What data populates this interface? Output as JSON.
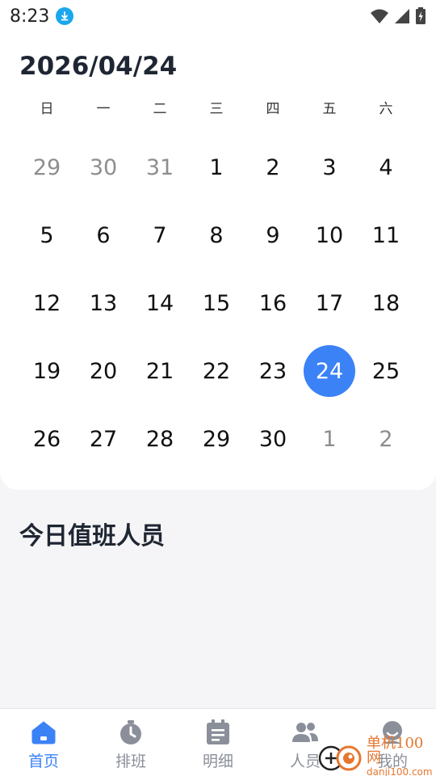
{
  "status_bar": {
    "time": "8:23"
  },
  "calendar": {
    "date_title": "2026/04/24",
    "weekdays": [
      "日",
      "一",
      "二",
      "三",
      "四",
      "五",
      "六"
    ],
    "days": [
      {
        "label": "29",
        "muted": true
      },
      {
        "label": "30",
        "muted": true
      },
      {
        "label": "31",
        "muted": true
      },
      {
        "label": "1"
      },
      {
        "label": "2"
      },
      {
        "label": "3"
      },
      {
        "label": "4"
      },
      {
        "label": "5"
      },
      {
        "label": "6"
      },
      {
        "label": "7"
      },
      {
        "label": "8"
      },
      {
        "label": "9"
      },
      {
        "label": "10"
      },
      {
        "label": "11"
      },
      {
        "label": "12"
      },
      {
        "label": "13"
      },
      {
        "label": "14"
      },
      {
        "label": "15"
      },
      {
        "label": "16"
      },
      {
        "label": "17"
      },
      {
        "label": "18"
      },
      {
        "label": "19"
      },
      {
        "label": "20"
      },
      {
        "label": "21"
      },
      {
        "label": "22"
      },
      {
        "label": "23"
      },
      {
        "label": "24",
        "selected": true
      },
      {
        "label": "25"
      },
      {
        "label": "26"
      },
      {
        "label": "27"
      },
      {
        "label": "28"
      },
      {
        "label": "29"
      },
      {
        "label": "30"
      },
      {
        "label": "1",
        "muted": true
      },
      {
        "label": "2",
        "muted": true
      }
    ],
    "accent_color": "#3b82f6"
  },
  "section": {
    "title": "今日值班人员"
  },
  "tabs": [
    {
      "label": "首页",
      "icon": "home-icon",
      "active": true
    },
    {
      "label": "排班",
      "icon": "stopwatch-icon"
    },
    {
      "label": "明细",
      "icon": "clipboard-list-icon"
    },
    {
      "label": "人员",
      "icon": "people-icon"
    },
    {
      "label": "我的",
      "icon": "profile-icon"
    }
  ],
  "watermark": {
    "cn": "单机100网",
    "en": "danji100.com"
  }
}
